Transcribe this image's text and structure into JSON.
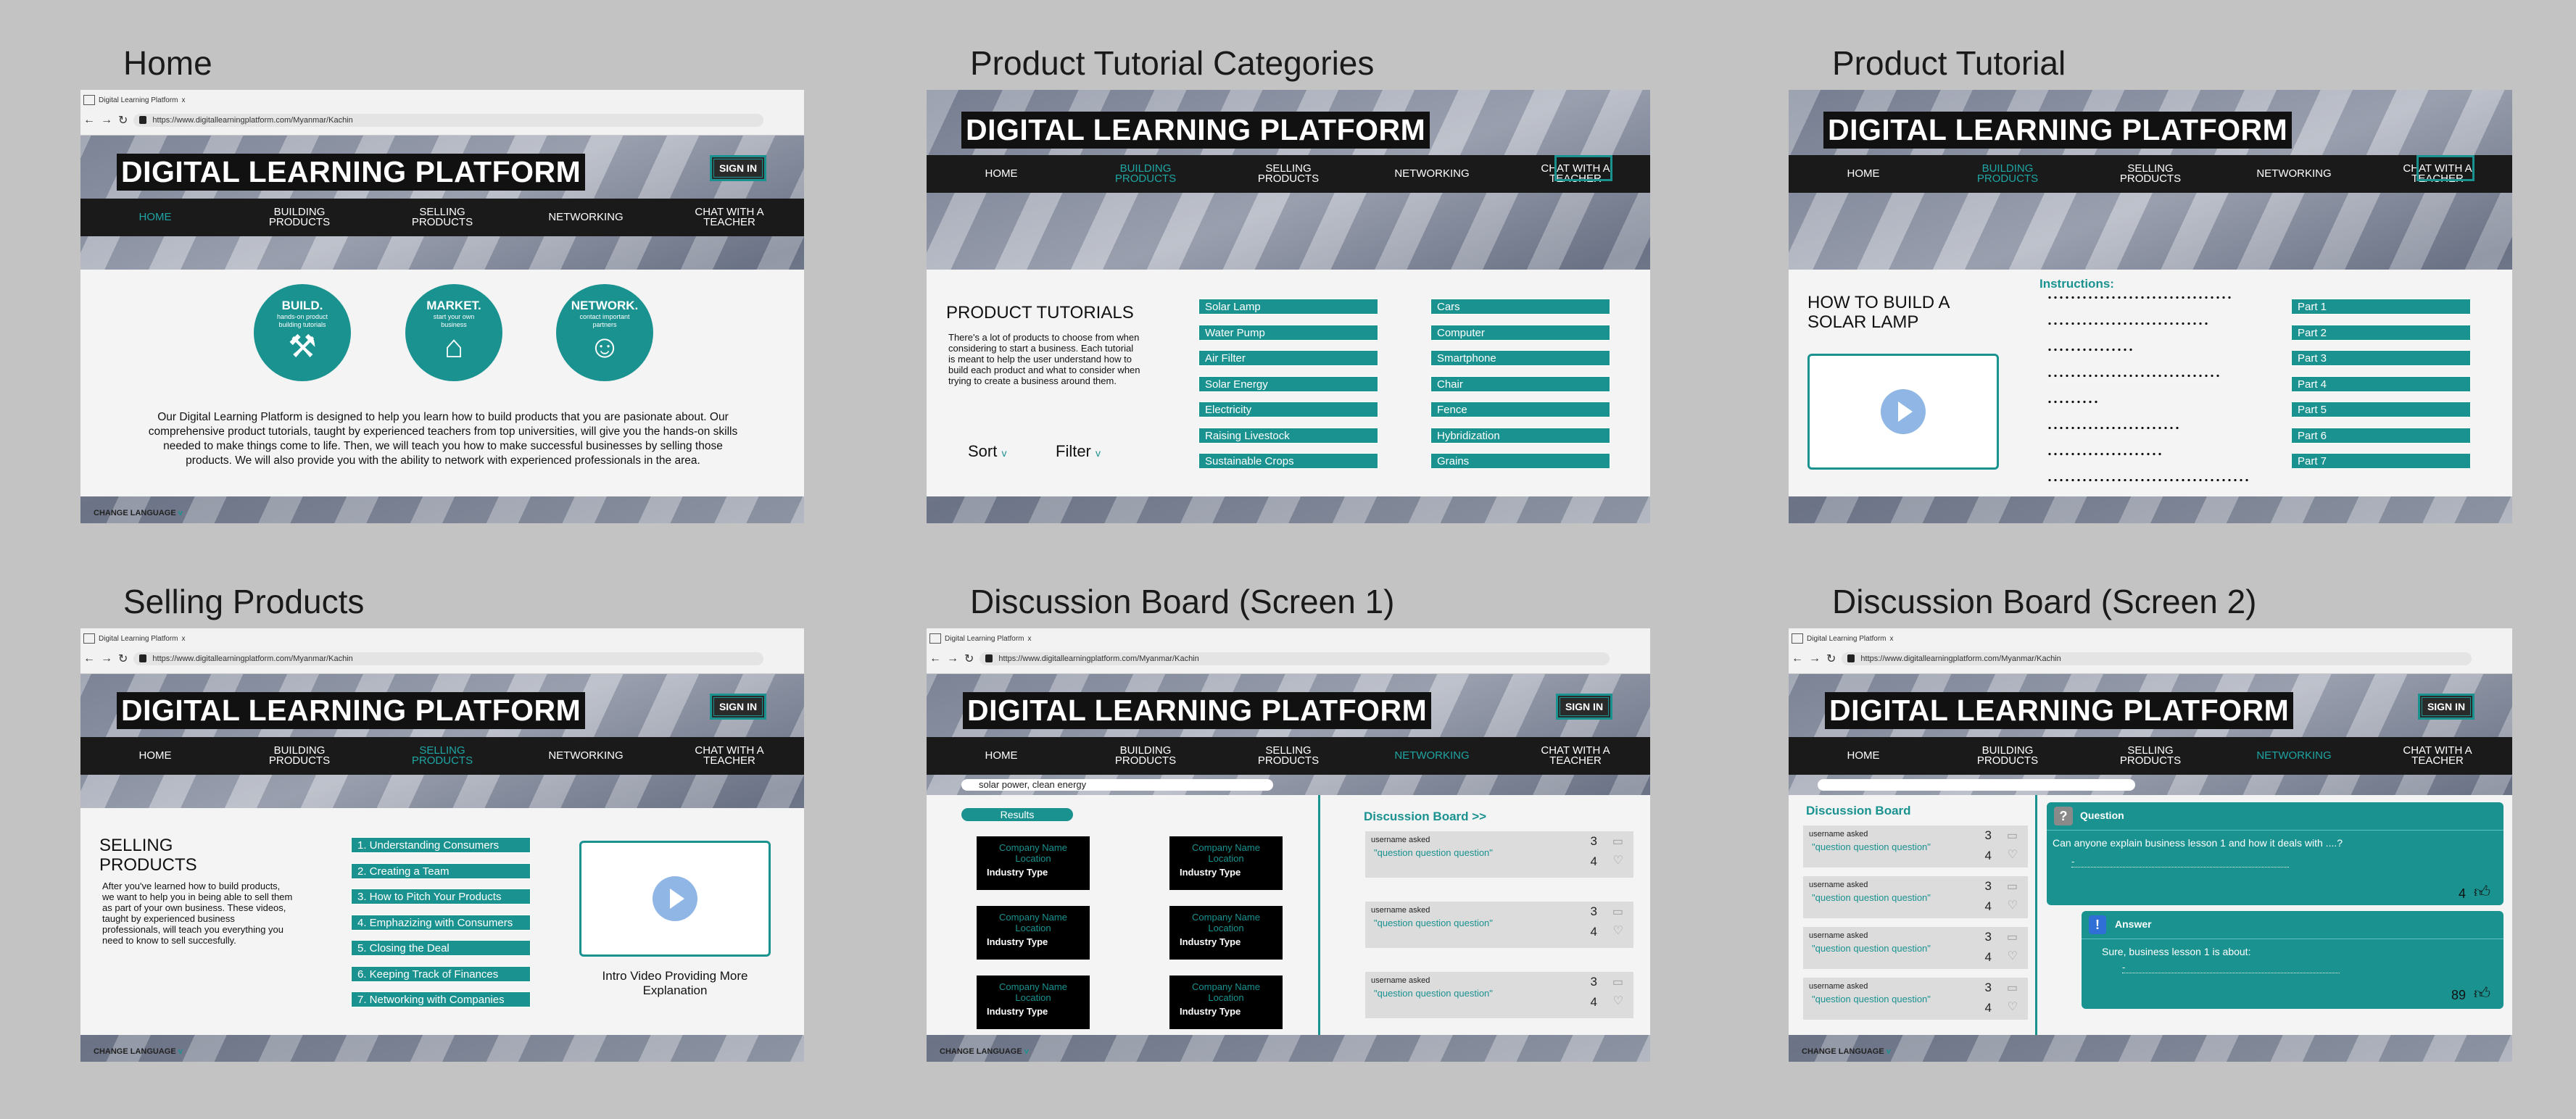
{
  "titles": {
    "home": "Home",
    "categories": "Product Tutorial Categories",
    "tutorial": "Product Tutorial",
    "selling": "Selling Products",
    "disc1": "Discussion Board (Screen 1)",
    "disc2": "Discussion Board (Screen 2)"
  },
  "common": {
    "tab_label": "Digital Learning Platform",
    "tab_close": "x",
    "url": "https://www.digitallearningplatform.com/Myanmar/Kachin",
    "brand": "DIGITAL LEARNING PLATFORM",
    "sign_in": "SIGN IN",
    "nav": {
      "home": "HOME",
      "building": "BUILDING PRODUCTS",
      "selling": "SELLING PRODUCTS",
      "networking": "NETWORKING",
      "chat": "CHAT WITH A TEACHER"
    },
    "change_language": "CHANGE LANGUAGE",
    "chevron": "v"
  },
  "home": {
    "circles": [
      {
        "title": "BUILD.",
        "sub": "hands-on product building tutorials",
        "icon": "tools-icon"
      },
      {
        "title": "MARKET.",
        "sub": "start your own business",
        "icon": "store-icon"
      },
      {
        "title": "NETWORK.",
        "sub": "contact important partners",
        "icon": "people-icon"
      }
    ],
    "paragraph": "Our Digital Learning Platform is designed to help you learn how to build products that you are pasionate about. Our comprehensive product tutorials, taught by experienced teachers from top universities, will give you the hands-on skills needed to make things come to life. Then,  we will teach you how to make successful businesses by selling those products. We will also provide you with the ability to network with experienced professionals in the area."
  },
  "categories": {
    "heading": "PRODUCT TUTORIALS",
    "desc": "There's a lot of products to choose from when considering to start a business. Each tutorial is meant to help the user understand how to build each product and what to consider when trying to create a business around them.",
    "sort": "Sort",
    "filter": "Filter",
    "left": [
      "Solar Lamp",
      "Water Pump",
      "Air Filter",
      "Solar Energy",
      "Electricity",
      "Raising Livestock",
      "Sustainable Crops"
    ],
    "right": [
      "Cars",
      "Computer",
      "Smartphone",
      "Chair",
      "Fence",
      "Hybridization",
      "Grains"
    ]
  },
  "tutorial": {
    "heading": "HOW TO BUILD A SOLAR LAMP",
    "instructions": "Instructions:",
    "parts": [
      "Part 1",
      "Part 2",
      "Part 3",
      "Part 4",
      "Part 5",
      "Part 6",
      "Part 7"
    ]
  },
  "selling": {
    "heading": "SELLING PRODUCTS",
    "desc": "After you've learned how to build products, we want to help you in being able to sell them as part of your own business. These videos, taught by experienced business professionals, will teach you everything you need to know to sell succesfully.",
    "items": [
      "1. Understanding Consumers",
      "2. Creating a Team",
      "3. How to Pitch Your Products",
      "4. Emphazizing with Consumers",
      "5. Closing the Deal",
      "6. Keeping Track of Finances",
      "7. Networking with Companies"
    ],
    "video_caption": "Intro Video Providing More Explanation"
  },
  "disc1": {
    "search": "solar power, clean energy",
    "results": "Results",
    "cards": [
      {
        "name": "Company Name",
        "location": "Location",
        "type": "Industry Type"
      },
      {
        "name": "Company Name",
        "location": "Location",
        "type": "Industry Type"
      },
      {
        "name": "Company Name",
        "location": "Location",
        "type": "Industry Type"
      },
      {
        "name": "Company Name",
        "location": "Location",
        "type": "Industry Type"
      },
      {
        "name": "Company Name",
        "location": "Location",
        "type": "Industry Type"
      },
      {
        "name": "Company Name",
        "location": "Location",
        "type": "Industry Type"
      }
    ],
    "board_title": "Discussion Board >>",
    "posts": [
      {
        "user": "username asked",
        "question": "\"question question question\"",
        "replies": "3",
        "likes": "4"
      },
      {
        "user": "username asked",
        "question": "\"question question question\"",
        "replies": "3",
        "likes": "4"
      },
      {
        "user": "username asked",
        "question": "\"question question question\"",
        "replies": "3",
        "likes": "4"
      }
    ]
  },
  "disc2": {
    "board_title": "Discussion Board",
    "posts": [
      {
        "user": "username asked",
        "question": "\"question question question\"",
        "replies": "3",
        "likes": "4"
      },
      {
        "user": "username asked",
        "question": "\"question question question\"",
        "replies": "3",
        "likes": "4"
      },
      {
        "user": "username asked",
        "question": "\"question question question\"",
        "replies": "3",
        "likes": "4"
      },
      {
        "user": "username asked",
        "question": "\"question question question\"",
        "replies": "3",
        "likes": "4"
      }
    ],
    "question_label": "Question",
    "question_mark": "?",
    "question_text": "Can anyone explain business lesson 1 and how it deals with ....?",
    "question_likes": "4",
    "answer_label": "Answer",
    "answer_mark": "!",
    "answer_text": "Sure, business lesson 1 is about:",
    "answer_likes": "89",
    "dash": "-"
  },
  "colors": {
    "accent": "#1a9290",
    "dark": "#1a1a1a",
    "background": "#c3c3c3"
  }
}
